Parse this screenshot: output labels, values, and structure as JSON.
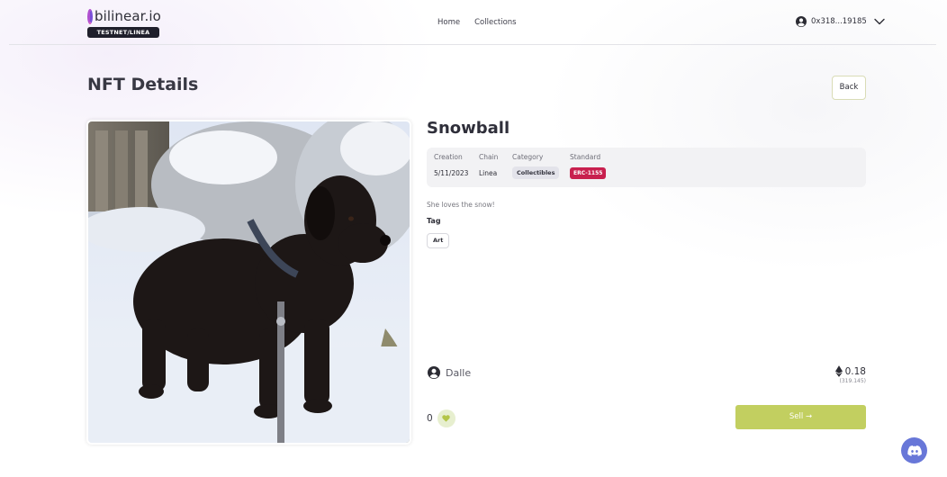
{
  "header": {
    "brand": "bilinear.io",
    "network_badge": "TESTNET/LINEA",
    "nav": {
      "home": "Home",
      "collections": "Collections"
    },
    "account_address": "0x318...19185"
  },
  "page": {
    "title": "NFT Details",
    "back_label": "Back"
  },
  "nft": {
    "name": "Snowball",
    "meta": {
      "creation_label": "Creation",
      "creation_value": "5/11/2023",
      "chain_label": "Chain",
      "chain_value": "Linea",
      "category_label": "Category",
      "category_value": "Collectibles",
      "standard_label": "Standard",
      "standard_value": "ERC-1155"
    },
    "description": "She loves the snow!",
    "tag_label": "Tag",
    "tags": [
      "Art"
    ],
    "owner": "Dalle",
    "price": "0.18",
    "price_usd": "(319.145)",
    "likes": "0",
    "sell_label": "Sell →"
  },
  "icons": {
    "user": "user-circle-icon",
    "chevron": "chevron-down-icon",
    "eth": "ethereum-icon",
    "heart": "heart-icon",
    "discord": "discord-icon"
  },
  "colors": {
    "accent": "#c2cf60",
    "standard_badge": "#c8204e",
    "discord": "#6877d8",
    "brand_ring": "#b04fd0"
  }
}
